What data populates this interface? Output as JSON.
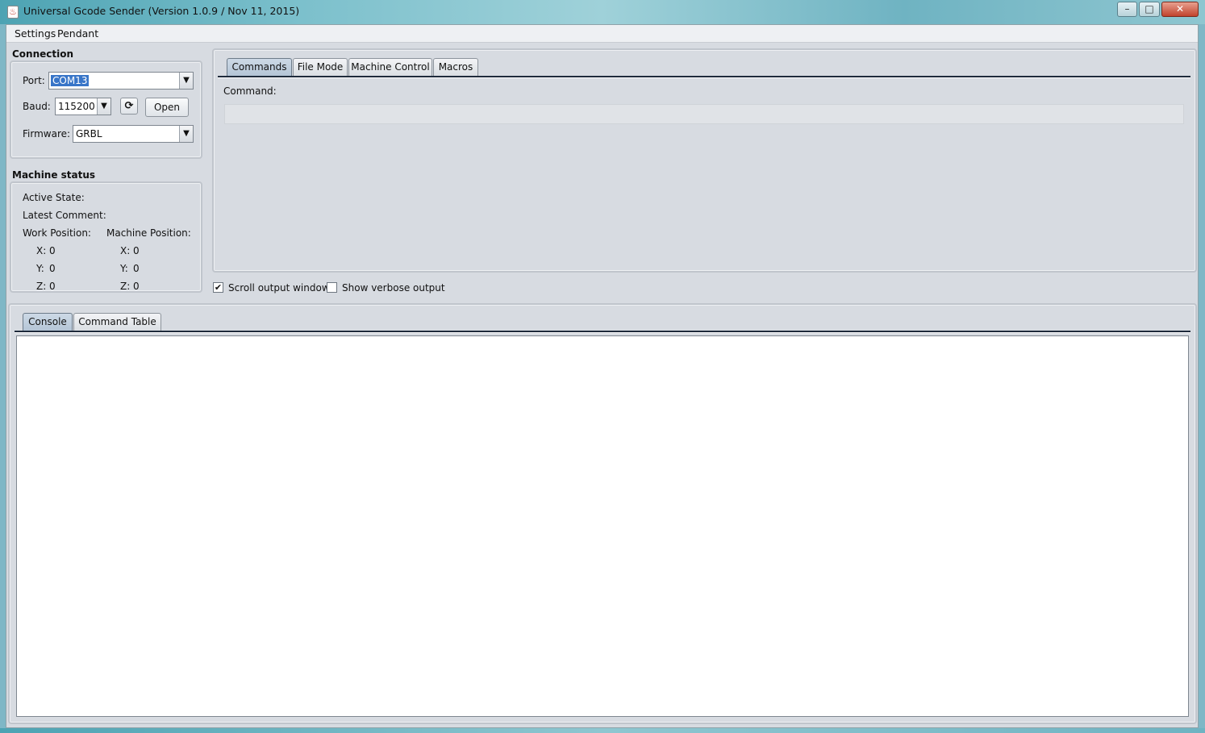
{
  "window": {
    "title": "Universal Gcode Sender (Version 1.0.9 / Nov 11, 2015)",
    "app_icon": "java-cup-icon",
    "minimize": "–",
    "maximize": "□",
    "close": "✕"
  },
  "menu": {
    "items": [
      "Settings",
      "Pendant"
    ]
  },
  "connection": {
    "title": "Connection",
    "port_label": "Port:",
    "port_value": "COM13",
    "baud_label": "Baud:",
    "baud_value": "115200",
    "refresh_icon": "refresh-icon",
    "open_label": "Open",
    "firmware_label": "Firmware:",
    "firmware_value": "GRBL"
  },
  "machine_status": {
    "title": "Machine status",
    "active_state_label": "Active State:",
    "latest_comment_label": "Latest Comment:",
    "work_position_label": "Work Position:",
    "machine_position_label": "Machine Position:",
    "work": {
      "x_label": "X:",
      "x": "0",
      "y_label": "Y:",
      "y": "0",
      "z_label": "Z:",
      "z": "0"
    },
    "machine": {
      "x_label": "X:",
      "x": "0",
      "y_label": "Y:",
      "y": "0",
      "z_label": "Z:",
      "z": "0"
    }
  },
  "top_tabs": {
    "items": [
      "Commands",
      "File Mode",
      "Machine Control",
      "Macros"
    ],
    "active": "Commands"
  },
  "commands": {
    "command_label": "Command:",
    "command_value": ""
  },
  "options": {
    "scroll_output_label": "Scroll output window",
    "scroll_output_checked": true,
    "verbose_label": "Show verbose output",
    "verbose_checked": false,
    "checkmark": "✔"
  },
  "bottom_tabs": {
    "items": [
      "Console",
      "Command Table"
    ],
    "active": "Console"
  }
}
